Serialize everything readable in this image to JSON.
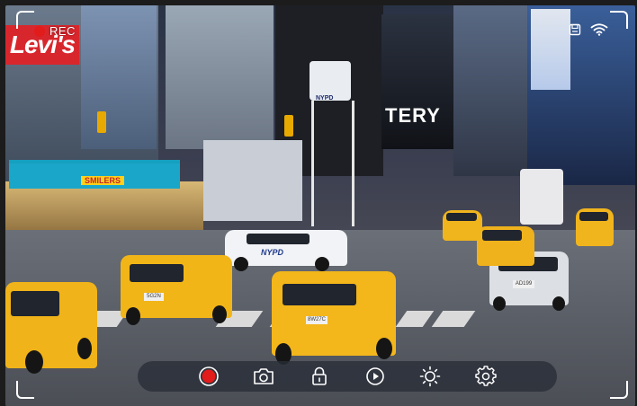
{
  "hud": {
    "rec_label": "REC",
    "rec_color": "#e21b1b",
    "status_icons": [
      "sd-card-icon",
      "wifi-icon"
    ]
  },
  "scene": {
    "sign_levis": "Levi's",
    "sign_smilers": "SMILERS",
    "billboard": "TERY",
    "tower_label": "NYPD",
    "police_car_label": "NYPD",
    "plate_front_taxi": "8W27C",
    "plate_right_car": "AD199",
    "plate_left_taxi": "5G2N"
  },
  "toolbar": {
    "buttons": [
      {
        "name": "record-button",
        "icon": "record-icon",
        "color": "#e21b1b"
      },
      {
        "name": "snapshot-button",
        "icon": "camera-icon"
      },
      {
        "name": "lock-button",
        "icon": "lock-icon"
      },
      {
        "name": "playback-button",
        "icon": "play-icon"
      },
      {
        "name": "brightness-button",
        "icon": "brightness-icon"
      },
      {
        "name": "settings-button",
        "icon": "gear-icon"
      }
    ]
  }
}
